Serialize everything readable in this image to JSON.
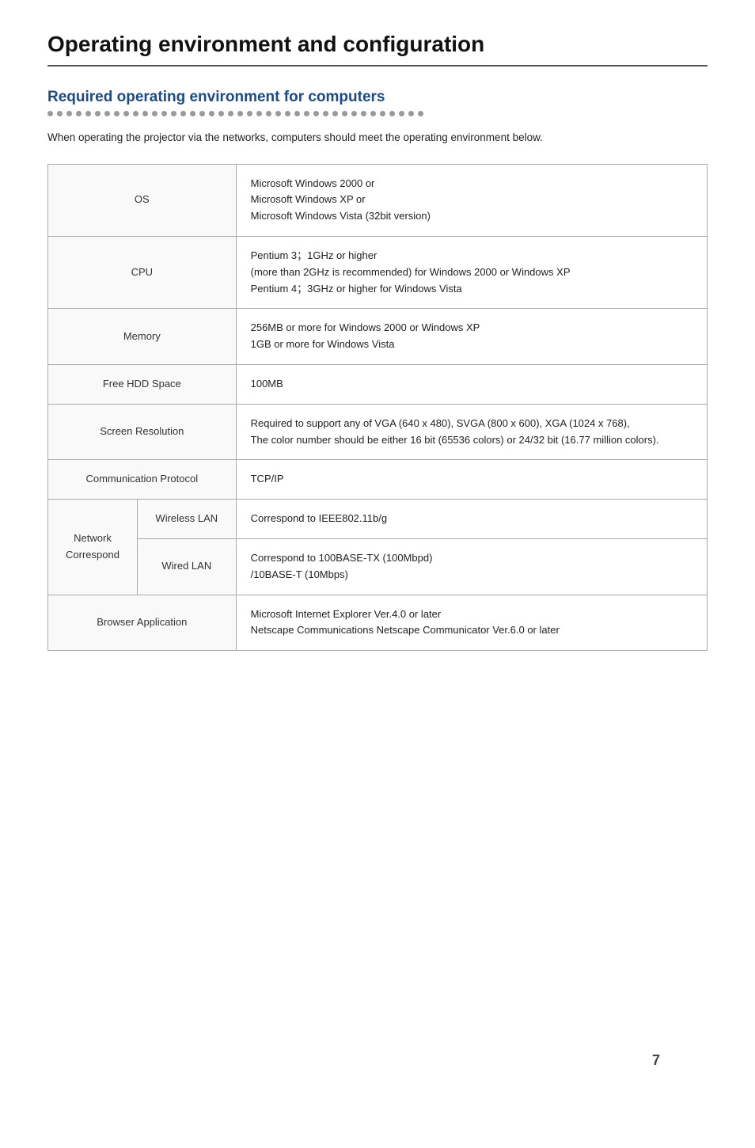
{
  "page": {
    "title": "Operating environment and configuration",
    "section_title": "Required operating environment for computers",
    "intro": "When operating the projector via the networks, computers should meet the operating environment below.",
    "page_number": "7"
  },
  "table": {
    "rows": [
      {
        "label": "OS",
        "value": "Microsoft Windows 2000 or\nMicrosoft Windows XP or\nMicrosoft Windows Vista (32bit version)"
      },
      {
        "label": "CPU",
        "value": "Pentium 3；1GHz or higher\n(more than 2GHz is recommended) for Windows 2000 or Windows XP\nPentium 4；3GHz or higher  for Windows Vista"
      },
      {
        "label": "Memory",
        "value": "256MB or more for Windows 2000 or Windows XP\n1GB or more for Windows Vista"
      },
      {
        "label": "Free HDD Space",
        "value": "100MB"
      },
      {
        "label": "Screen Resolution",
        "value": "Required to support any of VGA (640 x 480), SVGA (800 x 600), XGA (1024 x 768),\nThe color number should be either 16 bit (65536 colors) or 24/32 bit (16.77 million colors)."
      },
      {
        "label": "Communication Protocol",
        "value": "TCP/IP"
      }
    ],
    "network": {
      "outer_label": "Network\nCorrespond",
      "sub_rows": [
        {
          "sub_label": "Wireless LAN",
          "value": "Correspond to IEEE802.11b/g"
        },
        {
          "sub_label": "Wired LAN",
          "value": "Correspond to 100BASE-TX (100Mbpd)\n/10BASE-T (10Mbps)"
        }
      ]
    },
    "browser": {
      "label": "Browser Application",
      "value": "Microsoft Internet Explorer Ver.4.0 or later\nNetscape Communications Netscape Communicator Ver.6.0 or later"
    }
  },
  "dots_count": 40
}
